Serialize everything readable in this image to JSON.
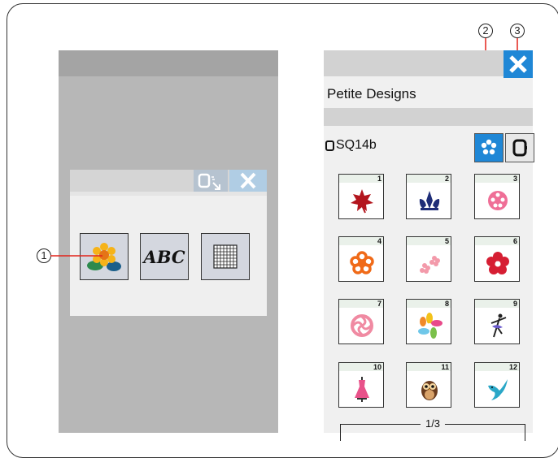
{
  "callouts": {
    "c1": "1",
    "c2": "2",
    "c3": "3"
  },
  "left_dialog": {
    "abc_label": "ABC",
    "icons": [
      "flower-design-icon",
      "abc-font-icon",
      "grid-icon",
      "hoop-select-icon",
      "close-icon"
    ]
  },
  "right_screen": {
    "title": "Petite Designs",
    "hoop": "SQ14b",
    "page": "1/3",
    "tiles": [
      {
        "num": "1",
        "icon": "maple-leaf-icon",
        "color": "#b3151d"
      },
      {
        "num": "2",
        "icon": "lotus-icon",
        "color": "#1e2d78"
      },
      {
        "num": "3",
        "icon": "pink-sphere-icon",
        "color": "#ef6f97"
      },
      {
        "num": "4",
        "icon": "orange-flower-icon",
        "color": "#f06a18"
      },
      {
        "num": "5",
        "icon": "pink-blossoms-icon",
        "color": "#f39aaa"
      },
      {
        "num": "6",
        "icon": "red-flower-icon",
        "color": "#d61e33"
      },
      {
        "num": "7",
        "icon": "pink-rosette-icon",
        "color": "#f08aa2"
      },
      {
        "num": "8",
        "icon": "pinwheel-flower-icon",
        "color": "#6fc7e9"
      },
      {
        "num": "9",
        "icon": "ballerina-icon",
        "color": "#222222"
      },
      {
        "num": "10",
        "icon": "pink-dress-icon",
        "color": "#e8528a"
      },
      {
        "num": "11",
        "icon": "owl-icon",
        "color": "#6b3d1f"
      },
      {
        "num": "12",
        "icon": "bird-icon",
        "color": "#2aa7c7"
      }
    ]
  },
  "colors": {
    "accent_blue": "#1f87d6",
    "callout_line": "#e2231a"
  }
}
